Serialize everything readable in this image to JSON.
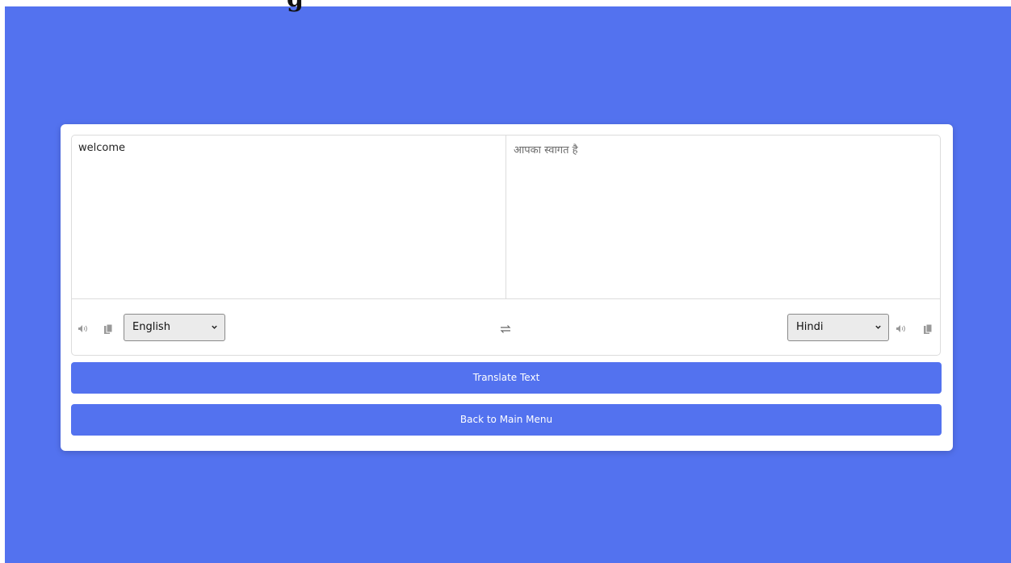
{
  "page": {
    "heading": "g"
  },
  "colors": {
    "background": "#5372ef",
    "card": "#ffffff",
    "button": "#5372ef"
  },
  "translator": {
    "from_text": "welcome",
    "to_text": "आपका स्वागत है",
    "from_language": "English",
    "to_language": "Hindi"
  },
  "icons": {
    "speaker": "speaker-icon",
    "copy": "copy-icon",
    "exchange": "exchange-icon"
  },
  "buttons": {
    "translate_label": "Translate Text",
    "back_label": "Back to Main Menu"
  }
}
